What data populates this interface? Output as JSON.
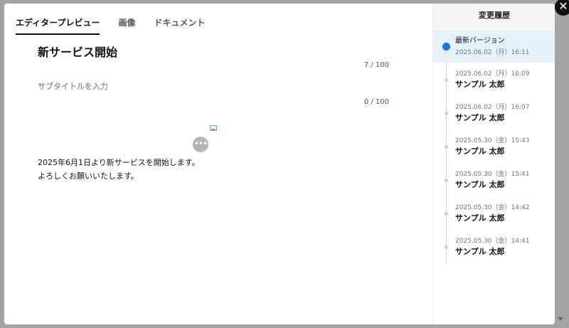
{
  "tabs": [
    {
      "label": "エディタープレビュー",
      "active": true
    },
    {
      "label": "画像",
      "active": false
    },
    {
      "label": "ドキュメント",
      "active": false
    }
  ],
  "editor": {
    "title": "新サービス開始",
    "title_counter": "7 / 100",
    "subtitle_placeholder": "サブタイトルを入力",
    "subtitle_counter": "0 / 100",
    "more_label": "•••",
    "body_lines": [
      "2025年6月1日より新サービスを開始します。",
      "よろしくお願いいたします。"
    ]
  },
  "history": {
    "title": "変更履歴",
    "current": {
      "label": "最新バージョン",
      "date": "2025.06.02（月）16:11"
    },
    "items": [
      {
        "date": "2025.06.02（月）16:09",
        "name": "サンプル 太郎"
      },
      {
        "date": "2025.06.02（月）16:07",
        "name": "サンプル 太郎"
      },
      {
        "date": "2025.05.30（金）15:43",
        "name": "サンプル 太郎"
      },
      {
        "date": "2025.05.30（金）15:41",
        "name": "サンプル 太郎"
      },
      {
        "date": "2025.05.30（金）14:42",
        "name": "サンプル 太郎"
      },
      {
        "date": "2025.05.30（金）14:41",
        "name": "サンプル 太郎"
      }
    ]
  },
  "close_label": "✕",
  "colors": {
    "accent": "#1a73e8",
    "current_bg": "#e5f2fb"
  },
  "icons": {
    "close": "close-icon",
    "more": "more-horizontal-icon",
    "image": "image-icon",
    "scroll": "scroll-down-icon"
  }
}
